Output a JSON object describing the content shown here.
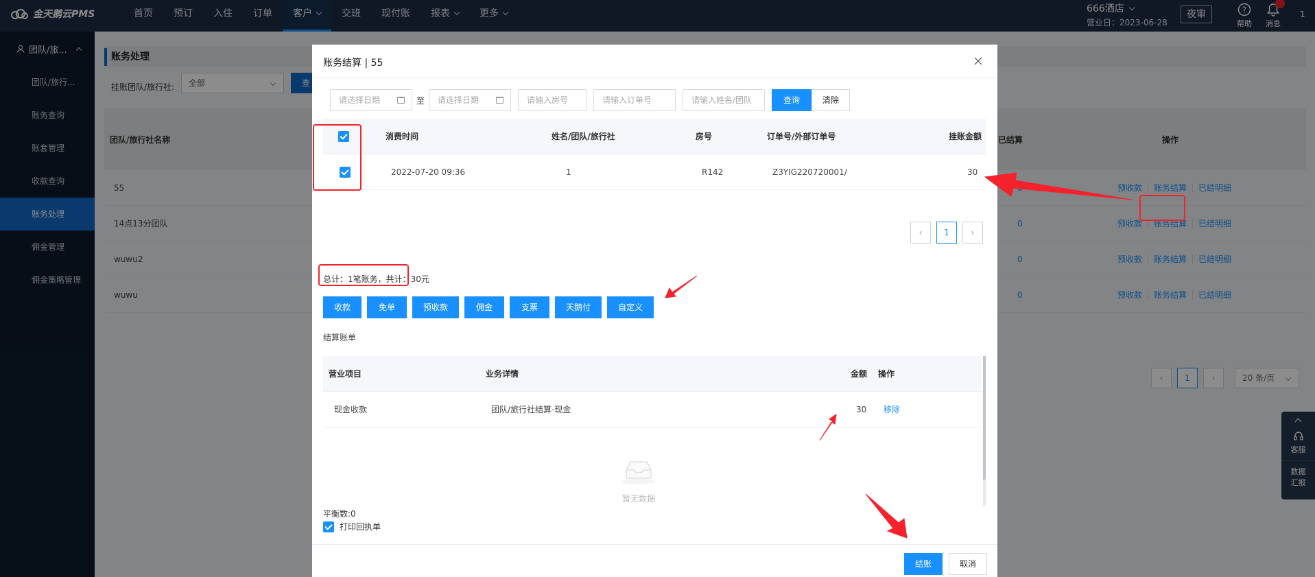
{
  "brand": {
    "logo_text": "金天鹅云PMS"
  },
  "nav": {
    "items": [
      {
        "label": "首页",
        "dropdown": false
      },
      {
        "label": "预订",
        "dropdown": false
      },
      {
        "label": "入住",
        "dropdown": false
      },
      {
        "label": "订单",
        "dropdown": false
      },
      {
        "label": "客户",
        "dropdown": true,
        "active": true
      },
      {
        "label": "交班",
        "dropdown": false
      },
      {
        "label": "现付账",
        "dropdown": false
      },
      {
        "label": "报表",
        "dropdown": true
      },
      {
        "label": "更多",
        "dropdown": true
      }
    ]
  },
  "hotel": {
    "name": "666酒店",
    "business_date": "营业日：2023-06-28",
    "night_audit": "夜审"
  },
  "top_icons": {
    "help": "帮助",
    "messages": "消息",
    "more": "1"
  },
  "sidebar": {
    "group": "团队/旅...",
    "items": [
      {
        "label": "团队/旅行..."
      },
      {
        "label": "账务查询"
      },
      {
        "label": "账套管理"
      },
      {
        "label": "收款查询"
      },
      {
        "label": "账务处理",
        "active": true
      },
      {
        "label": "佣金管理"
      },
      {
        "label": "佣金策略管理"
      }
    ]
  },
  "page": {
    "title": "账务处理",
    "filter_label": "挂账团队/旅行社:",
    "filter_value": "全部",
    "filter_button": "查询",
    "table": {
      "col_name": "团队/旅行社名称",
      "col_settle": "已结算",
      "col_ops": "操作",
      "rows": [
        {
          "name": "55",
          "settled": "0"
        },
        {
          "name": "14点13分团队",
          "settled": "0"
        },
        {
          "name": "wuwu2",
          "settled": "0"
        },
        {
          "name": "wuwu",
          "settled": "0"
        }
      ],
      "op_labels": {
        "prepay": "预收款",
        "settle": "账务结算",
        "detail": "已结明细"
      }
    },
    "pager": {
      "current": "1",
      "page_size": "20 条/页"
    }
  },
  "float_panel": {
    "service": "客服",
    "report_line1": "数据",
    "report_line2": "汇报"
  },
  "modal": {
    "title": "账务结算 | 55",
    "search": {
      "start_date_placeholder": "请选择日期",
      "to": "至",
      "end_date_placeholder": "请选择日期",
      "room_placeholder": "请输入房号",
      "order_placeholder": "请输入订单号",
      "name_placeholder": "请输入姓名/团队",
      "query": "查询",
      "clear": "清除"
    },
    "table": {
      "headers": {
        "time": "消费时间",
        "name": "姓名/团队/旅行社",
        "room": "房号",
        "order": "订单号/外部订单号",
        "amount": "挂账金额"
      },
      "rows": [
        {
          "time": "2022-07-20 09:36",
          "name": "1",
          "room": "R142",
          "order": "Z3YIG220720001/",
          "amount": "30"
        }
      ]
    },
    "pager": {
      "current": "1"
    },
    "summary": "总计：1笔账务，共计：30元",
    "actions": [
      "收款",
      "免单",
      "预收款",
      "佣金",
      "支票",
      "天鹅付",
      "自定义"
    ],
    "bill_label": "结算账单",
    "bill": {
      "headers": {
        "item": "营业项目",
        "detail": "业务详情",
        "amount": "金额",
        "op": "操作"
      },
      "rows": [
        {
          "item": "现金收款",
          "detail": "团队/旅行社结算-现金",
          "amount": "30",
          "op": "移除"
        }
      ],
      "empty": "暂无数据"
    },
    "balance": "平衡数:0",
    "print_receipt": "打印回执单",
    "settle_button": "结账",
    "cancel_button": "取消"
  },
  "colors": {
    "primary": "#1890ff",
    "nav_bg": "#1f2d44",
    "sidebar_bg": "#0d1b2b",
    "annotation": "#f5222d"
  }
}
